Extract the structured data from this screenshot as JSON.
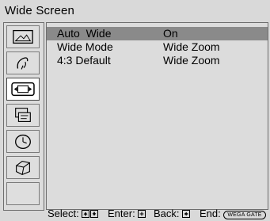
{
  "title": "Wide Screen",
  "sidebar": {
    "icons": [
      {
        "name": "picture-icon"
      },
      {
        "name": "sound-icon"
      },
      {
        "name": "wide-screen-icon",
        "active": true
      },
      {
        "name": "channel-icon"
      },
      {
        "name": "timer-icon"
      },
      {
        "name": "setup-icon"
      },
      {
        "name": "empty-slot"
      }
    ]
  },
  "menu": {
    "rows": [
      {
        "label": "Auto  Wide",
        "value": "On",
        "selected": true
      },
      {
        "label": "Wide Mode",
        "value": "Wide Zoom",
        "selected": false
      },
      {
        "label": "4:3 Default",
        "value": "Wide Zoom",
        "selected": false
      }
    ]
  },
  "footer": {
    "select_label": "Select:",
    "enter_label": "Enter:",
    "back_label": "Back:",
    "end_label": "End:",
    "end_button": "WEGA GATE"
  }
}
